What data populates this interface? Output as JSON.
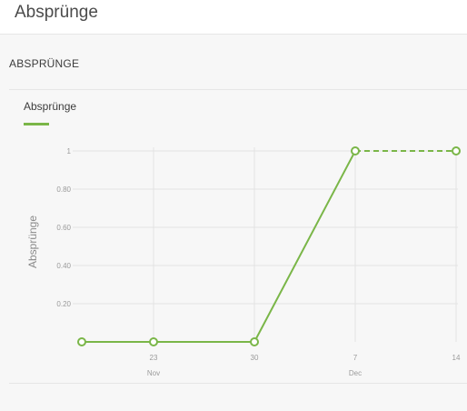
{
  "page": {
    "title": "Absprünge"
  },
  "panel": {
    "title": "ABSPRÜNGE"
  },
  "legend": {
    "series_label": "Absprünge"
  },
  "colors": {
    "series": "#7ab648",
    "grid": "#e3e3e3",
    "tick_text": "#9a9a9a",
    "axis_title": "#8a8a8a"
  },
  "chart_data": {
    "type": "line",
    "ylabel": "Absprünge",
    "xlabel": "",
    "ylim": [
      0,
      1
    ],
    "y_ticks": [
      "1",
      "0.80",
      "0.60",
      "0.40",
      "0.20"
    ],
    "x_ticks": [
      {
        "label": "23",
        "sublabel": "Nov"
      },
      {
        "label": "30",
        "sublabel": ""
      },
      {
        "label": "7",
        "sublabel": "Dec"
      },
      {
        "label": "14",
        "sublabel": ""
      }
    ],
    "series": [
      {
        "name": "Absprünge",
        "solid_points": [
          {
            "x": "16 Nov",
            "y": 0
          },
          {
            "x": "23 Nov",
            "y": 0
          },
          {
            "x": "30 Nov",
            "y": 0
          },
          {
            "x": "7 Dec",
            "y": 1
          }
        ],
        "dashed_points": [
          {
            "x": "7 Dec",
            "y": 1
          },
          {
            "x": "14 Dec",
            "y": 1
          }
        ]
      }
    ],
    "grid": true
  }
}
